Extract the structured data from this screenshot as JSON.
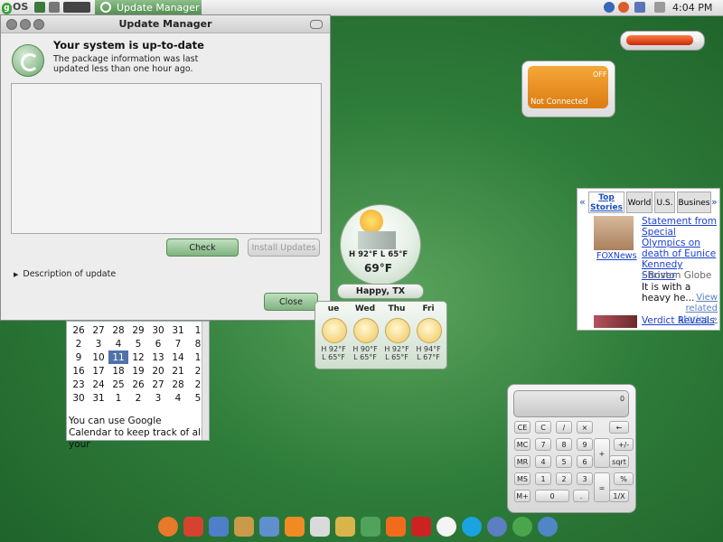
{
  "top_panel": {
    "logo_text": "OS",
    "task_button_label": "Update Manager",
    "clock": "4:04 PM"
  },
  "update_manager": {
    "title": "Update Manager",
    "heading": "Your system is up-to-date",
    "subtext": "The package information was last updated less than one hour ago.",
    "check_button": "Check",
    "install_button": "Install Updates",
    "description_toggle": "Description of update",
    "close_button": "Close"
  },
  "calendar": {
    "rows": [
      [
        "26",
        "27",
        "28",
        "29",
        "30",
        "31",
        "1"
      ],
      [
        "2",
        "3",
        "4",
        "5",
        "6",
        "7",
        "8"
      ],
      [
        "9",
        "10",
        "11",
        "12",
        "13",
        "14",
        "1"
      ],
      [
        "16",
        "17",
        "18",
        "19",
        "20",
        "21",
        "2"
      ],
      [
        "23",
        "24",
        "25",
        "26",
        "27",
        "28",
        "2"
      ],
      [
        "30",
        "31",
        "1",
        "2",
        "3",
        "4",
        "5"
      ]
    ],
    "selected": "11",
    "text": "You can use Google Calendar to keep track of all your"
  },
  "weather": {
    "current_range": "H 92°F  L 65°F",
    "current_temp": "69°F",
    "city": "Happy, TX",
    "days": [
      {
        "name": "ue",
        "high": "H 92°F",
        "low": "L 65°F"
      },
      {
        "name": "Wed",
        "high": "H 90°F",
        "low": "L 65°F"
      },
      {
        "name": "Thu",
        "high": "H 92°F",
        "low": "L 65°F"
      },
      {
        "name": "Fri",
        "high": "H 94°F",
        "low": "L 67°F"
      }
    ]
  },
  "battery": {
    "value": "0"
  },
  "network": {
    "toggle": "OFF",
    "status": "Not Connected"
  },
  "news": {
    "nav_left": "«",
    "nav_right": "»",
    "tabs": [
      "Top Stories",
      "World",
      "U.S.",
      "Busines"
    ],
    "story1": {
      "headline": "Statement from Special Olympics on death of Eunice Kennedy Shriver",
      "image_source": "FOXNews",
      "source": "- Boston Globe",
      "snippet": "It is with a heavy he...",
      "related": "View related stories »"
    },
    "story2": {
      "headline": "Verdict Reveals"
    }
  },
  "calculator": {
    "display": "0",
    "keys": [
      [
        "CE",
        "C",
        "/",
        "×",
        "←"
      ],
      [
        "MC",
        "7",
        "8",
        "9",
        "+",
        "+/-"
      ],
      [
        "MR",
        "4",
        "5",
        "6",
        "sqrt"
      ],
      [
        "MS",
        "1",
        "2",
        "3",
        "=",
        "%"
      ],
      [
        "M+",
        "0",
        ".",
        "1/X"
      ]
    ]
  },
  "dock": {
    "icons": [
      "firefox-icon",
      "gmail-icon",
      "calendar-icon",
      "photos-icon",
      "image-editor-icon",
      "rss-icon",
      "document-icon",
      "shopping-icon",
      "picture-icon",
      "blogger-icon",
      "youtube-icon",
      "chat-icon",
      "skype-icon",
      "openoffice-writer-icon",
      "openoffice-calc-icon",
      "openoffice-impress-icon"
    ],
    "colors": [
      "#e8792a",
      "#d6422f",
      "#4f7fc8",
      "#c99a4a",
      "#5f8fcf",
      "#f08a24",
      "#dadada",
      "#d9b44a",
      "#4fa35a",
      "#f26b1d",
      "#cc2222",
      "#f4f4f4",
      "#1aa3e0",
      "#5b7fc0",
      "#4aa64a",
      "#4f86c6"
    ]
  }
}
